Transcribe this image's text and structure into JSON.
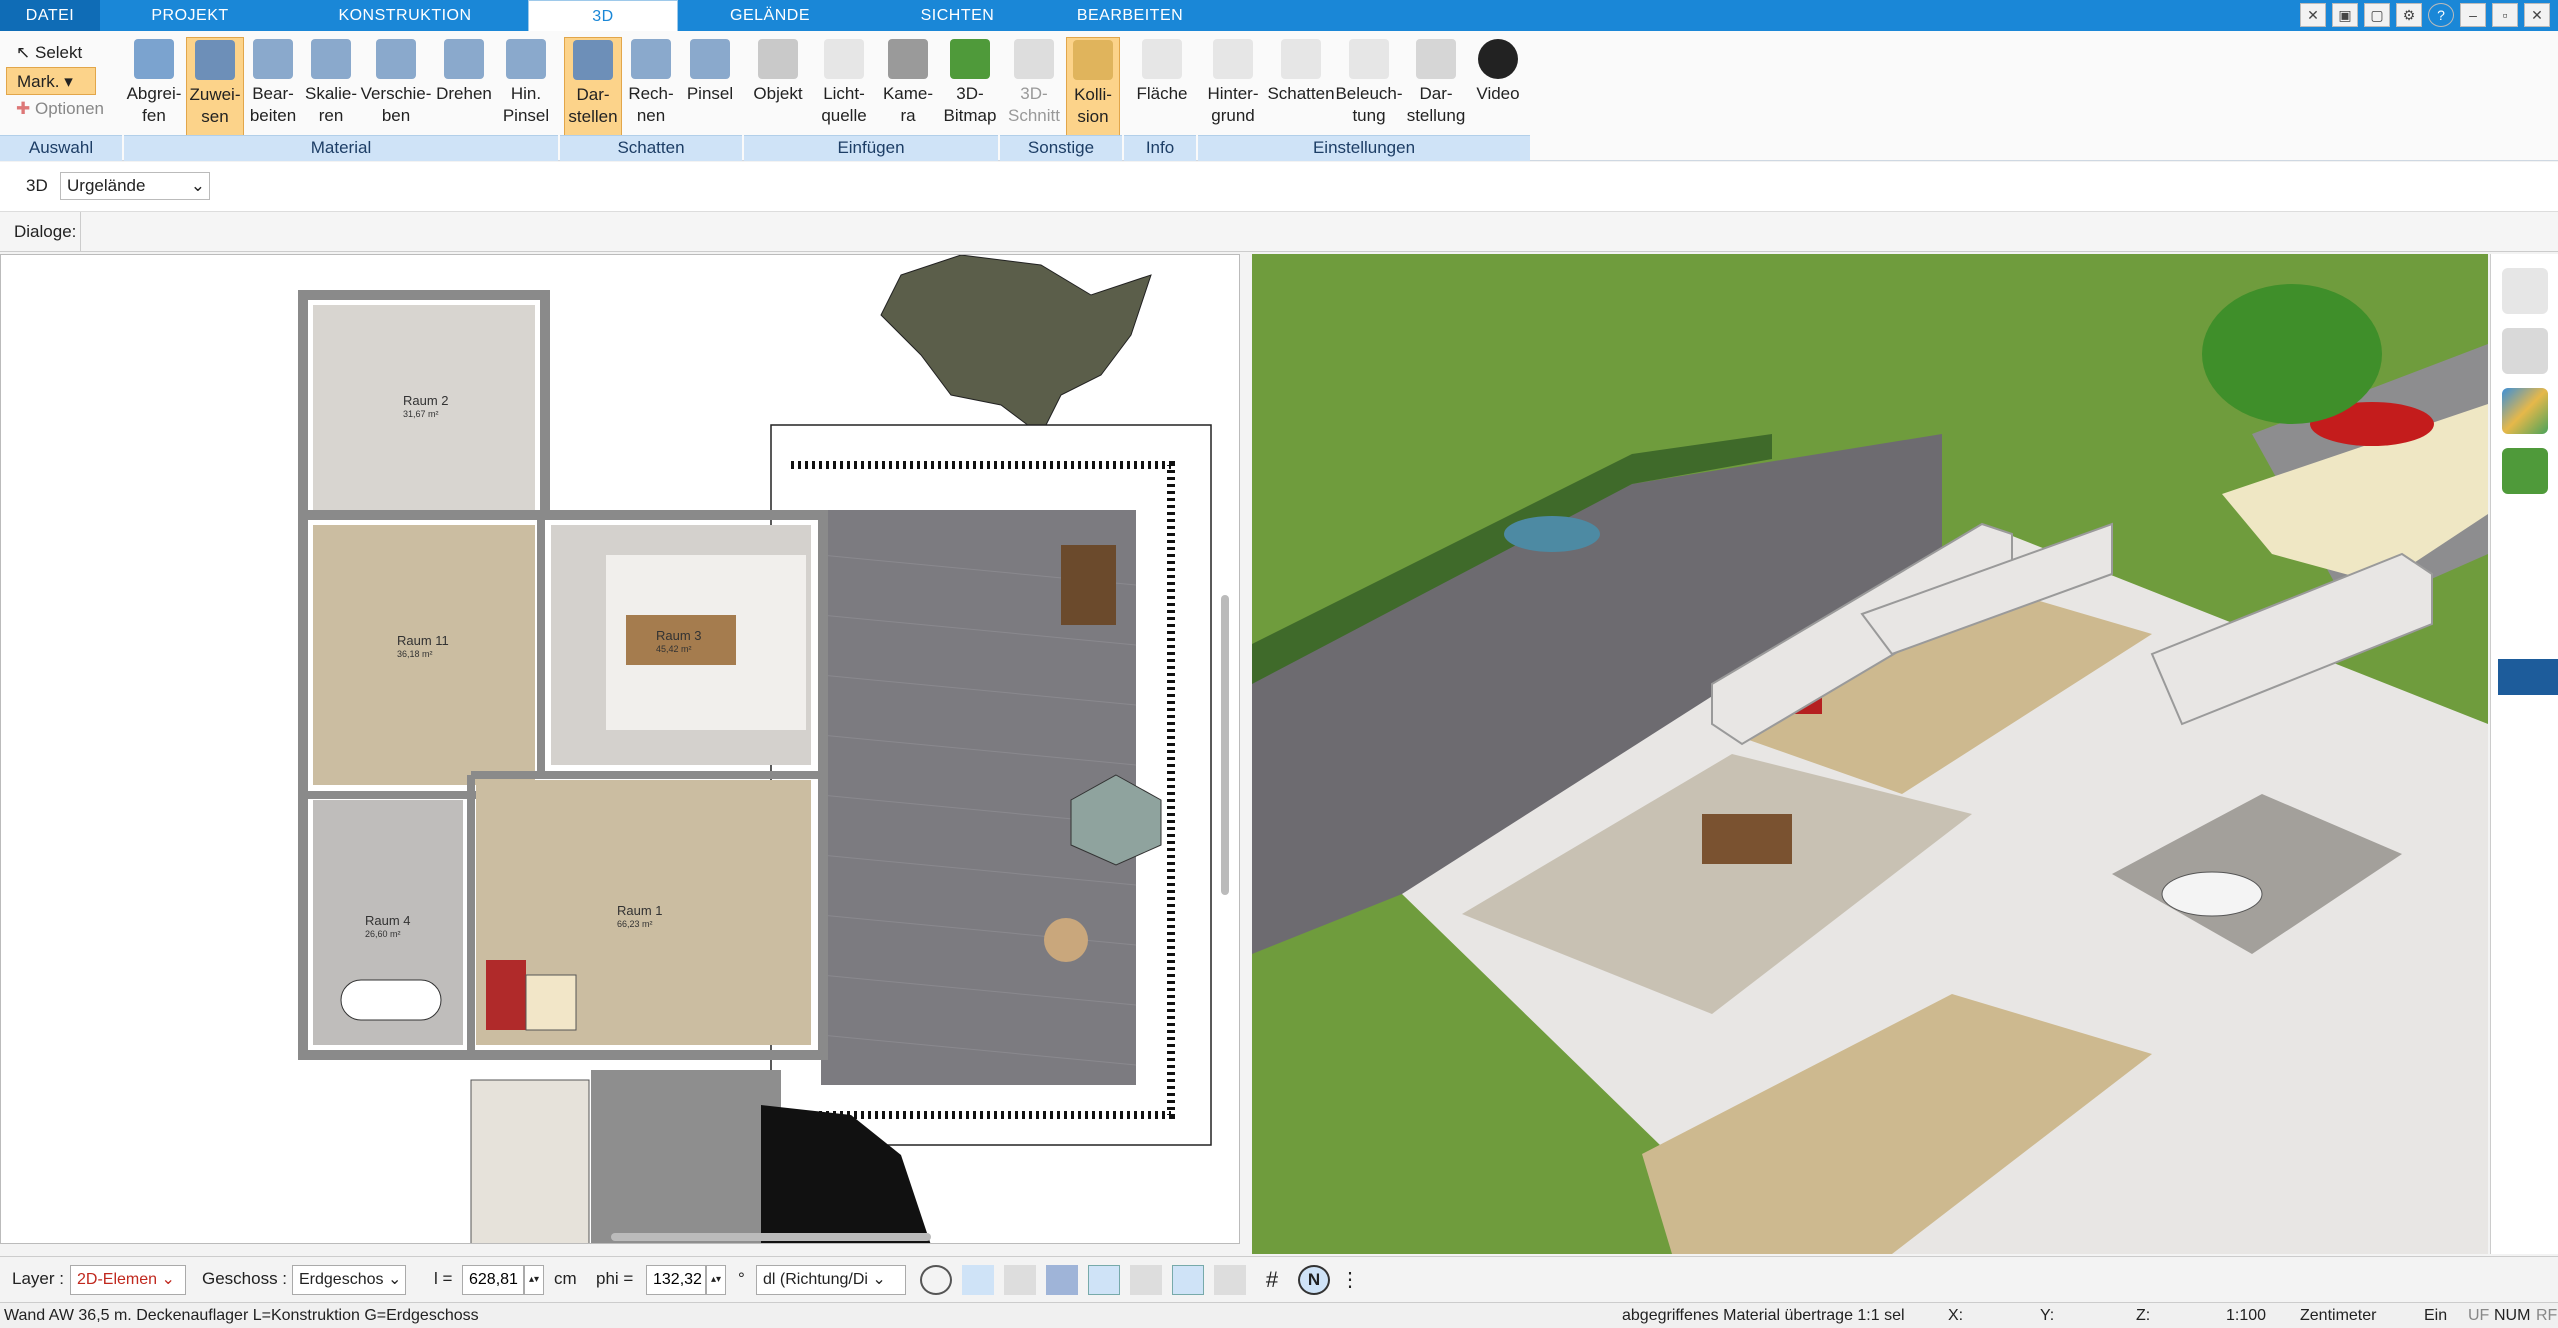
{
  "menu": {
    "file": "DATEI",
    "tabs": [
      "PROJEKT",
      "KONSTRUKTION",
      "3D",
      "GELÄNDE",
      "SICHTEN",
      "BEARBEITEN"
    ]
  },
  "selection": {
    "select": "Selekt",
    "mark": "Mark.",
    "options": "Optionen",
    "group": "Auswahl"
  },
  "ribbon": {
    "material": {
      "group": "Material",
      "buttons": [
        "Abgrei-\nfen",
        "Zuwei-\nsen",
        "Bear-\nbeiten",
        "Skalie-\nren",
        "Verschie-\nben",
        "Drehen",
        "Hin.\nPinsel"
      ]
    },
    "schatten": {
      "group": "Schatten",
      "buttons": [
        "Dar-\nstellen",
        "Rech-\nnen",
        "Pinsel"
      ]
    },
    "einfuegen": {
      "group": "Einfügen",
      "buttons": [
        "Objekt",
        "Licht-\nquelle",
        "Kame-\nra",
        "3D-\nBitmap"
      ]
    },
    "sonstige": {
      "group": "Sonstige",
      "buttons": [
        "3D-\nSchnitt",
        "Kolli-\nsion"
      ]
    },
    "info": {
      "group": "Info",
      "buttons": [
        "Fläche"
      ]
    },
    "einstellungen": {
      "group": "Einstellungen",
      "buttons": [
        "Hinter-\ngrund",
        "Schatten",
        "Beleuch-\ntung",
        "Dar-\nstellung",
        "Video"
      ]
    }
  },
  "toolbar2": {
    "mode": "3D",
    "terrain": "Urgelände"
  },
  "toolbar3": {
    "dialoge": "Dialoge:"
  },
  "plan": {
    "rooms": [
      {
        "name": "Raum 2",
        "area": "31,67 m²"
      },
      {
        "name": "Raum 11",
        "area": "36,18 m²"
      },
      {
        "name": "Raum 3",
        "area": "45,42 m²"
      },
      {
        "name": "Raum 1",
        "area": "66,23 m²"
      },
      {
        "name": "Raum 4",
        "area": "26,60 m²"
      }
    ]
  },
  "bottom": {
    "layer_label": "Layer :",
    "layer_value": "2D-Elemen",
    "geschoss_label": "Geschoss :",
    "geschoss_value": "Erdgeschos",
    "l_label": "l =",
    "l_value": "628,81",
    "l_unit": "cm",
    "phi_label": "phi =",
    "phi_value": "132,32",
    "phi_unit": "°",
    "dl_value": "dl (Richtung/Di"
  },
  "status": {
    "left": "Wand AW 36,5 m. Deckenauflager L=Konstruktion G=Erdgeschoss",
    "middle": "abgegriffenes Material übertrage 1:1 sel",
    "x": "X:",
    "y": "Y:",
    "z": "Z:",
    "scale": "1:100",
    "unit": "Zentimeter",
    "ein": "Ein",
    "uf": "UF",
    "num": "NUM",
    "rf": "RF"
  },
  "colors": {
    "accent": "#1a87d7",
    "ribbon_group": "#cfe3f7",
    "selected": "#fcd38a",
    "grass": "#6b9a3a"
  }
}
